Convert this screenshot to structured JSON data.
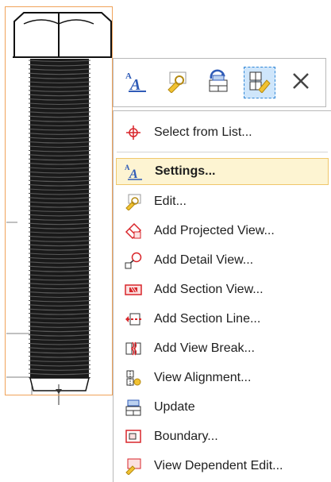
{
  "toolbar": {
    "buttons": [
      {
        "icon": "view-settings-icon"
      },
      {
        "icon": "edit-view-icon"
      },
      {
        "icon": "update-view-icon"
      },
      {
        "icon": "view-dependent-edit-icon",
        "selected": true
      },
      {
        "icon": "close-icon"
      }
    ]
  },
  "menu": {
    "items": [
      {
        "id": "select-from-list",
        "label": "Select from List...",
        "icon": "crosshair-icon"
      },
      {
        "id": "settings",
        "label": "Settings...",
        "icon": "view-settings-icon",
        "bold": true,
        "highlighted": true
      },
      {
        "id": "edit",
        "label": "Edit...",
        "icon": "edit-view-icon"
      },
      {
        "id": "add-projected-view",
        "label": "Add Projected View...",
        "icon": "projected-view-icon"
      },
      {
        "id": "add-detail-view",
        "label": "Add Detail View...",
        "icon": "detail-view-icon"
      },
      {
        "id": "add-section-view",
        "label": "Add Section View...",
        "icon": "section-view-icon"
      },
      {
        "id": "add-section-line",
        "label": "Add Section Line...",
        "icon": "section-line-icon"
      },
      {
        "id": "add-view-break",
        "label": "Add View Break...",
        "icon": "view-break-icon"
      },
      {
        "id": "view-alignment",
        "label": "View Alignment...",
        "icon": "view-alignment-icon"
      },
      {
        "id": "update",
        "label": "Update",
        "icon": "update-view-icon"
      },
      {
        "id": "boundary",
        "label": "Boundary...",
        "icon": "boundary-icon"
      },
      {
        "id": "view-dependent-edit",
        "label": "View Dependent Edit...",
        "icon": "view-dependent-edit-icon"
      }
    ]
  },
  "colors": {
    "accent_blue": "#2f5bb7",
    "highlight_bg": "#fdf4d2",
    "highlight_border": "#f0c76a",
    "view_frame": "#f0a35a",
    "icon_red": "#d9262b",
    "icon_yellow": "#f1c232"
  }
}
